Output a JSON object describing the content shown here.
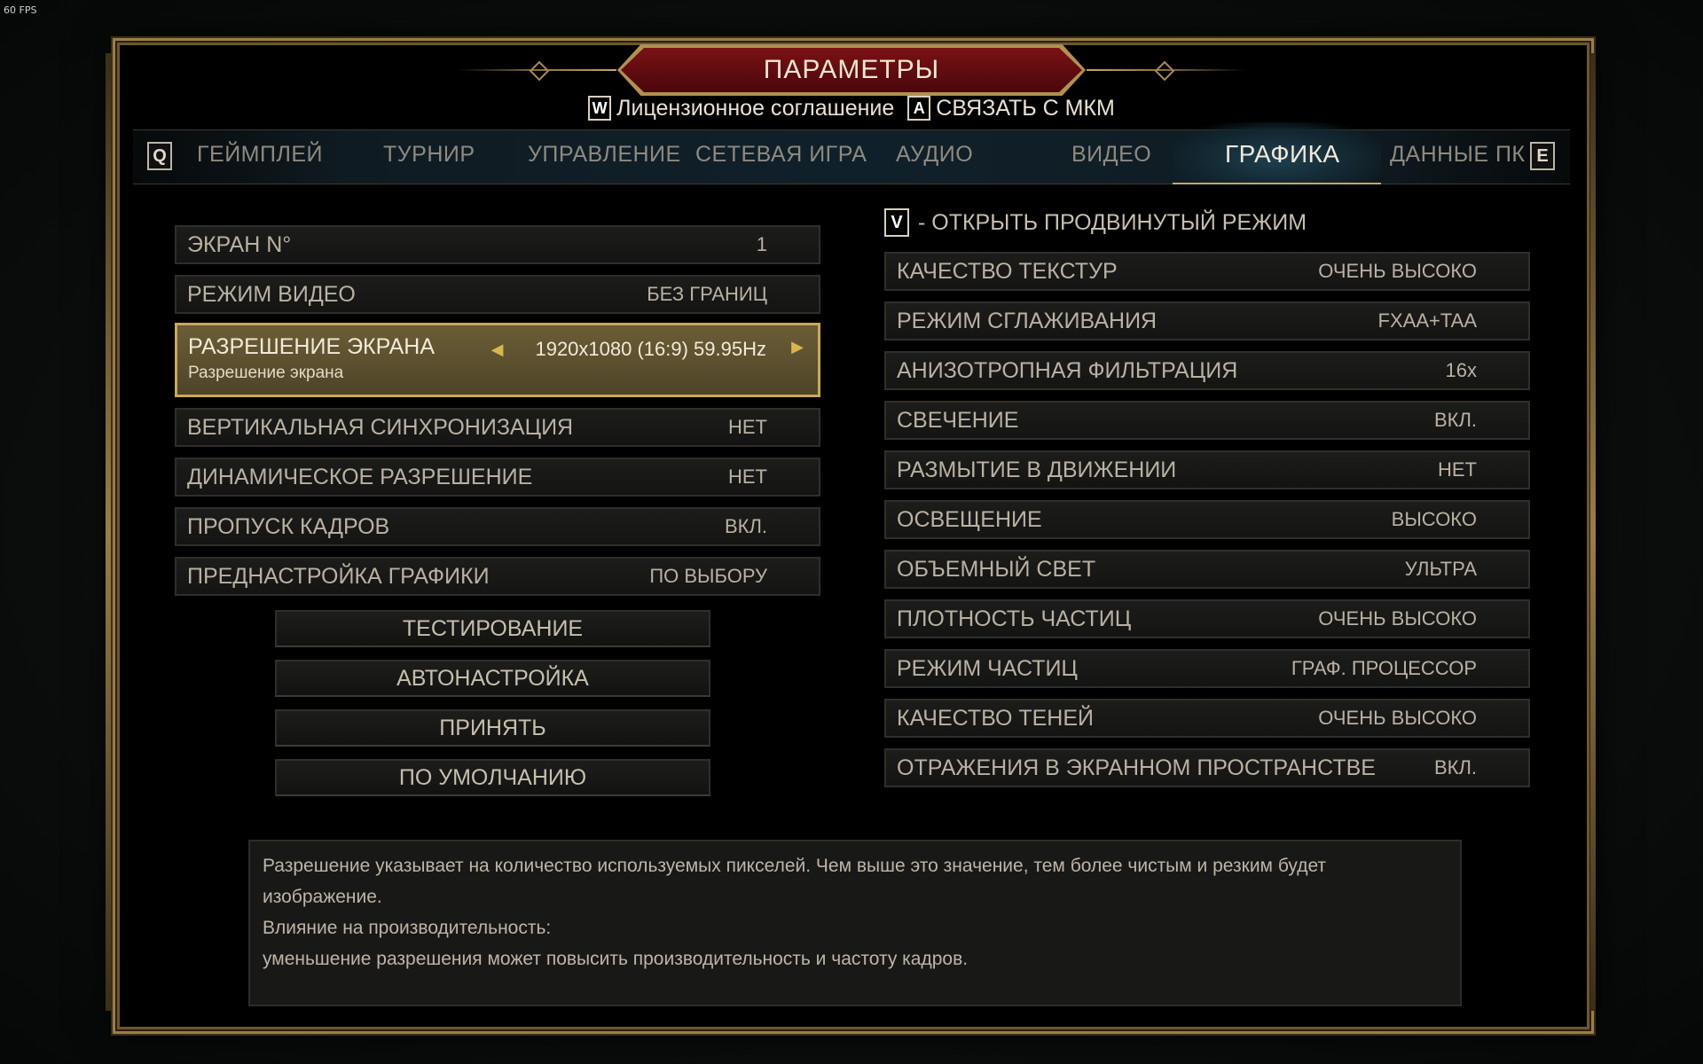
{
  "fps": "60 FPS",
  "title": "ПАРАМЕТРЫ",
  "subheader": {
    "license": {
      "key": "W",
      "label": "Лицензионное соглашение"
    },
    "link": {
      "key": "A",
      "label": "СВЯЗАТЬ С МКМ"
    }
  },
  "tabs": {
    "prev_key": "Q",
    "next_key": "E",
    "items": [
      "ГЕЙМПЛЕЙ",
      "ТУРНИР",
      "УПРАВЛЕНИЕ",
      "СЕТЕВАЯ ИГРА",
      "АУДИО",
      "ВИДЕО",
      "ГРАФИКА",
      "ДАННЫЕ ПК"
    ],
    "active": "ГРАФИКА"
  },
  "left_settings": [
    {
      "label": "ЭКРАН N°",
      "value": "1"
    },
    {
      "label": "РЕЖИМ ВИДЕО",
      "value": "БЕЗ ГРАНИЦ"
    },
    {
      "label": "РАЗРЕШЕНИЕ ЭКРАНА",
      "sub": "Разрешение экрана",
      "value": "1920x1080 (16:9) 59.95Hz",
      "selected": true
    },
    {
      "label": "ВЕРТИКАЛЬНАЯ СИНХРОНИЗАЦИЯ",
      "value": "НЕТ"
    },
    {
      "label": "ДИНАМИЧЕСКОЕ РАЗРЕШЕНИЕ",
      "value": "НЕТ"
    },
    {
      "label": "ПРОПУСК КАДРОВ",
      "value": "ВКЛ."
    },
    {
      "label": "ПРЕДНАСТРОЙКА ГРАФИКИ",
      "value": "ПО ВЫБОРУ"
    }
  ],
  "buttons": {
    "test": "ТЕСТИРОВАНИЕ",
    "auto": "АВТОНАСТРОЙКА",
    "apply": "ПРИНЯТЬ",
    "default": "ПО УМОЛЧАНИЮ"
  },
  "advanced": {
    "key": "V",
    "label": "- ОТКРЫТЬ ПРОДВИНУТЫЙ РЕЖИМ"
  },
  "right_settings": [
    {
      "label": "КАЧЕСТВО ТЕКСТУР",
      "value": "ОЧЕНЬ ВЫСОКО"
    },
    {
      "label": "РЕЖИМ СГЛАЖИВАНИЯ",
      "value": "FXAA+TAA"
    },
    {
      "label": "АНИЗОТРОПНАЯ ФИЛЬТРАЦИЯ",
      "value": "16x"
    },
    {
      "label": "СВЕЧЕНИЕ",
      "value": "ВКЛ."
    },
    {
      "label": "РАЗМЫТИЕ В ДВИЖЕНИИ",
      "value": "НЕТ"
    },
    {
      "label": "ОСВЕЩЕНИЕ",
      "value": "ВЫСОКО"
    },
    {
      "label": "ОБЪЕМНЫЙ СВЕТ",
      "value": "УЛЬТРА"
    },
    {
      "label": "ПЛОТНОСТЬ ЧАСТИЦ",
      "value": "ОЧЕНЬ ВЫСОКО"
    },
    {
      "label": "РЕЖИМ ЧАСТИЦ",
      "value": "ГРАФ. ПРОЦЕССОР"
    },
    {
      "label": "КАЧЕСТВО ТЕНЕЙ",
      "value": "ОЧЕНЬ ВЫСОКО"
    },
    {
      "label": "ОТРАЖЕНИЯ В ЭКРАННОМ ПРОСТРАНСТВЕ",
      "value": "ВКЛ."
    }
  ],
  "description": [
    "Разрешение указывает на количество используемых пикселей. Чем выше это значение, тем более чистым и резким будет изображение.",
    "Влияние на производительность:",
    "уменьшение разрешения может повысить производительность и частоту кадров."
  ],
  "colors": {
    "accent_gold": "#c9a85a",
    "title_red": "#7a1116",
    "tab_active": "#f2eadb"
  }
}
